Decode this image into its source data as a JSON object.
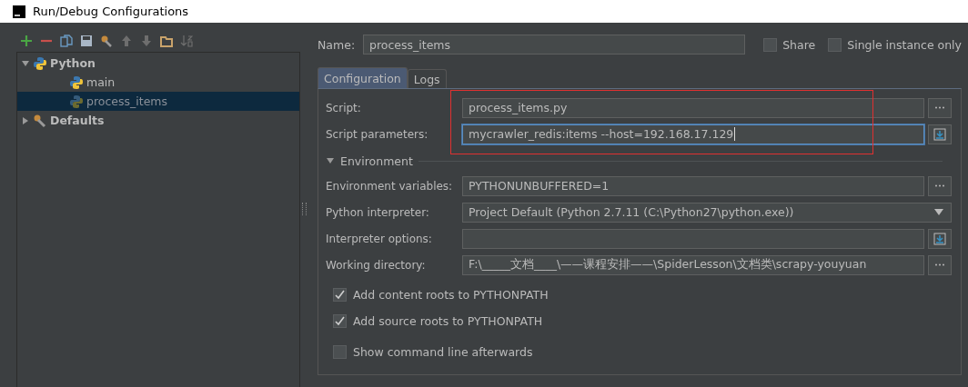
{
  "window": {
    "title": "Run/Debug Configurations"
  },
  "tree": [
    {
      "label": "Python",
      "kind": "python",
      "expanded": true,
      "selected": false,
      "children": [
        {
          "label": "main",
          "kind": "python-file",
          "selected": false
        },
        {
          "label": "process_items",
          "kind": "python-file",
          "selected": true
        }
      ]
    },
    {
      "label": "Defaults",
      "kind": "defaults",
      "expanded": false,
      "selected": false
    }
  ],
  "name": {
    "label": "Name:",
    "value": "process_items"
  },
  "options": [
    {
      "label": "Share",
      "checked": false
    },
    {
      "label": "Single instance only",
      "checked": false
    }
  ],
  "tabs": [
    {
      "label": "Configuration",
      "selected": true
    },
    {
      "label": "Logs",
      "selected": false
    }
  ],
  "script_rows": [
    {
      "label": "Script:",
      "value": "process_items.py",
      "kind": "browse",
      "focused": false
    },
    {
      "label": "Script parameters:",
      "value": "mycrawler_redis:items --host=192.168.17.129",
      "kind": "expand",
      "focused": true
    }
  ],
  "environment": {
    "label": "Environment",
    "expanded": true
  },
  "env_rows": [
    {
      "label": "Environment variables:",
      "value": "PYTHONUNBUFFERED=1",
      "kind": "browse",
      "focused": false
    },
    {
      "label": "Python interpreter:",
      "value": "Project Default (Python 2.7.11 (C:\\Python27\\python.exe))",
      "kind": "dropdown",
      "focused": false
    },
    {
      "label": "Interpreter options:",
      "value": "",
      "kind": "expand",
      "focused": false
    },
    {
      "label": "Working directory:",
      "value": "F:\\_____文档____\\——课程安排——\\SpiderLesson\\文档类\\scrapy-youyuan",
      "kind": "browse",
      "focused": false
    }
  ],
  "checkboxes": [
    {
      "label": "Add content roots to PYTHONPATH",
      "checked": true
    },
    {
      "label": "Add source roots to PYTHONPATH",
      "checked": true
    },
    {
      "label": "Show command line afterwards",
      "checked": false
    }
  ]
}
